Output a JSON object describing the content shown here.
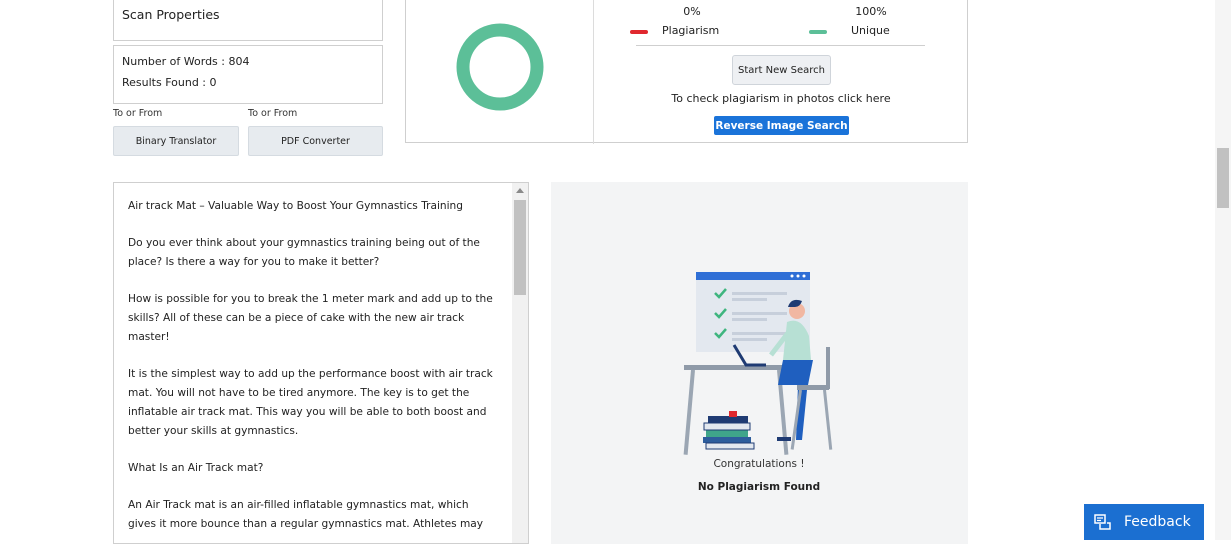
{
  "scan": {
    "title": "Scan Properties",
    "words": "Number of Words : 804",
    "results": "Results Found : 0"
  },
  "tools": {
    "left_label": "To or From",
    "right_label": "To or From",
    "left_button": "Binary Translator",
    "right_button": "PDF Converter"
  },
  "results_panel": {
    "plagiarism_pct": "0%",
    "unique_pct": "100%",
    "plagiarism_label": "Plagiarism",
    "unique_label": "Unique",
    "plagiarism_fraction": 0,
    "unique_fraction": 1,
    "new_search_button": "Start New Search",
    "photo_note": "To check plagiarism in photos click here",
    "reverse_button": "Reverse Image Search",
    "colors": {
      "plagiarism": "#e0282e",
      "unique": "#5cbf98"
    }
  },
  "document": {
    "paragraphs": [
      "Air track Mat – Valuable Way to Boost Your Gymnastics Training",
      "Do you ever think about your gymnastics training being out of the place? Is there a way for you to make it better?",
      "How is possible for you to break the 1 meter mark and add up to the skills? All of these can be a piece of cake with the new air track master!",
      "It is the simplest way to add up the performance boost with air track mat. You will not have to be tired anymore. The key is to get the inflatable air track mat. This way you will be able to both boost and better your skills at gymnastics.",
      "What Is an Air Track mat?",
      "An Air Track mat is an air-filled inflatable gymnastics mat, which gives it more bounce than a regular gymnastics mat. Athletes may"
    ]
  },
  "status": {
    "congrats": "Congratulations !",
    "no_plagiarism": "No Plagiarism Found"
  },
  "feedback": {
    "label": "Feedback"
  },
  "icons": [
    "scroll-up-arrow-icon",
    "feedback-icon",
    "checkmark-icon"
  ]
}
